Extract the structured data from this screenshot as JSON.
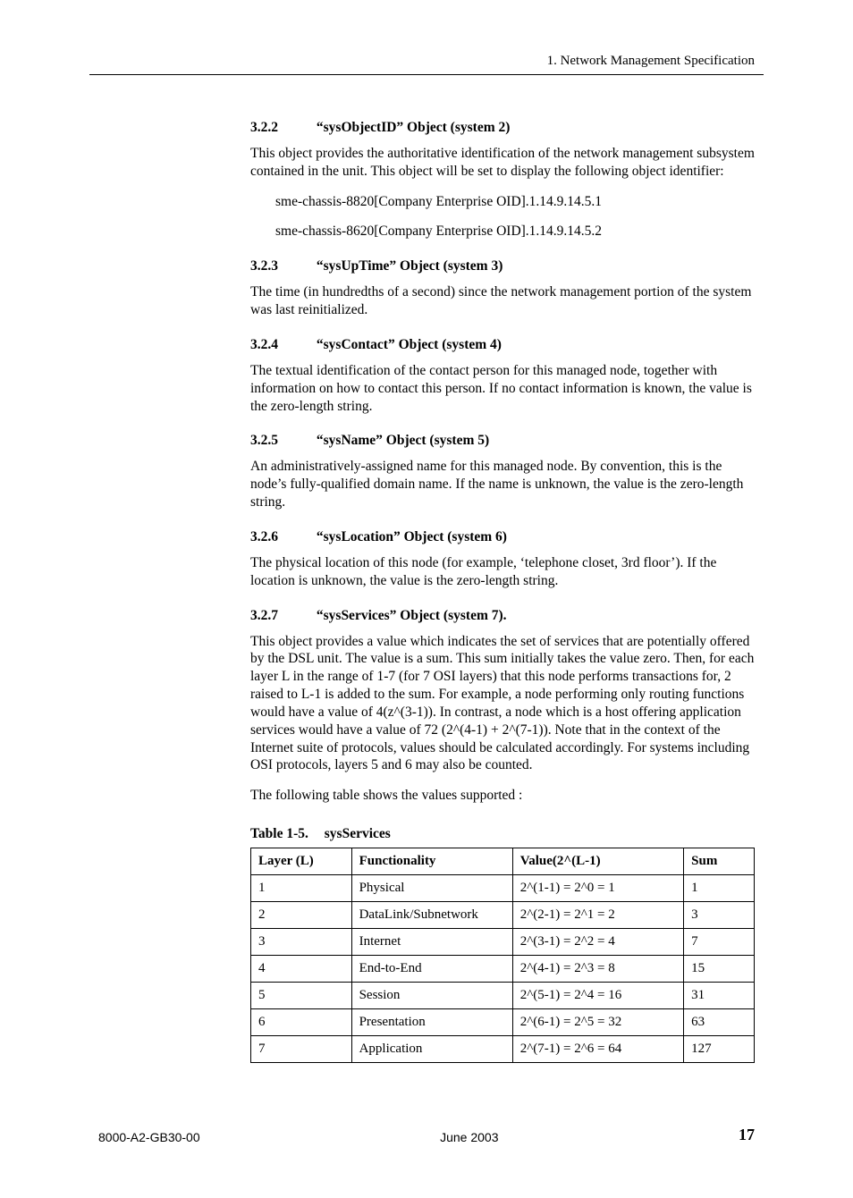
{
  "header": {
    "running": "1. Network Management Specification"
  },
  "sections": [
    {
      "num": "3.2.2",
      "title": "“sysObjectID” Object (system 2)",
      "paras": [
        "This object provides the authoritative identification of the network management subsystem contained in the unit. This object will be set to display the following object identifier:"
      ],
      "indented": [
        "sme-chassis-8820[Company Enterprise OID].1.14.9.14.5.1",
        "sme-chassis-8620[Company Enterprise OID].1.14.9.14.5.2"
      ]
    },
    {
      "num": "3.2.3",
      "title": "“sysUpTime” Object (system 3)",
      "paras": [
        "The time (in hundredths of a second) since the network management portion of the system was last reinitialized."
      ]
    },
    {
      "num": "3.2.4",
      "title": "“sysContact” Object (system 4)",
      "paras": [
        "The textual identification of the contact person for this managed node, together with information on how to contact this person.  If no contact information is known, the value is the zero-length string."
      ]
    },
    {
      "num": "3.2.5",
      "title": "“sysName” Object (system 5)",
      "paras": [
        "An administratively-assigned name for this managed node. By convention, this is the node’s fully-qualified domain name.  If the name is unknown, the value is the zero-length string."
      ]
    },
    {
      "num": "3.2.6",
      "title": "“sysLocation” Object (system 6)",
      "paras": [
        "The physical location of this node (for example, ‘telephone closet, 3rd floor’).  If the location is unknown, the value is the zero-length string."
      ]
    },
    {
      "num": "3.2.7",
      "title": "“sysServices” Object (system 7).",
      "paras": [
        "This object provides a value which indicates the set of services that are potentially offered by the DSL unit. The value is a sum. This sum initially takes the value zero. Then, for each layer L in the range of 1-7 (for 7 OSI layers) that this node performs transactions for, 2 raised to L-1 is added to the sum. For example, a node performing only routing functions would have a value of 4(z^(3-1)). In contrast, a node which is a host offering application services would have a value of 72 (2^(4-1) + 2^(7-1)). Note that in the context of the Internet suite of protocols, values should be calculated accordingly. For systems including OSI protocols, layers 5 and 6 may also be counted.",
        "The following table shows the values supported :"
      ]
    }
  ],
  "table": {
    "caption_num": "Table 1-5.",
    "caption_title": "sysServices",
    "headers": [
      "Layer (L)",
      "Functionality",
      "Value(2^(L-1)",
      "Sum"
    ],
    "rows": [
      [
        "1",
        "Physical",
        "2^(1-1) = 2^0 = 1",
        "1"
      ],
      [
        "2",
        "DataLink/Subnetwork",
        "2^(2-1) = 2^1 = 2",
        "3"
      ],
      [
        "3",
        "Internet",
        "2^(3-1) = 2^2 = 4",
        "7"
      ],
      [
        "4",
        "End-to-End",
        "2^(4-1) = 2^3 = 8",
        "15"
      ],
      [
        "5",
        "Session",
        "2^(5-1) = 2^4 = 16",
        "31"
      ],
      [
        "6",
        "Presentation",
        "2^(6-1) = 2^5 = 32",
        "63"
      ],
      [
        "7",
        "Application",
        "2^(7-1) = 2^6 = 64",
        "127"
      ]
    ]
  },
  "footer": {
    "left": "8000-A2-GB30-00",
    "center": "June 2003",
    "page": "17"
  }
}
